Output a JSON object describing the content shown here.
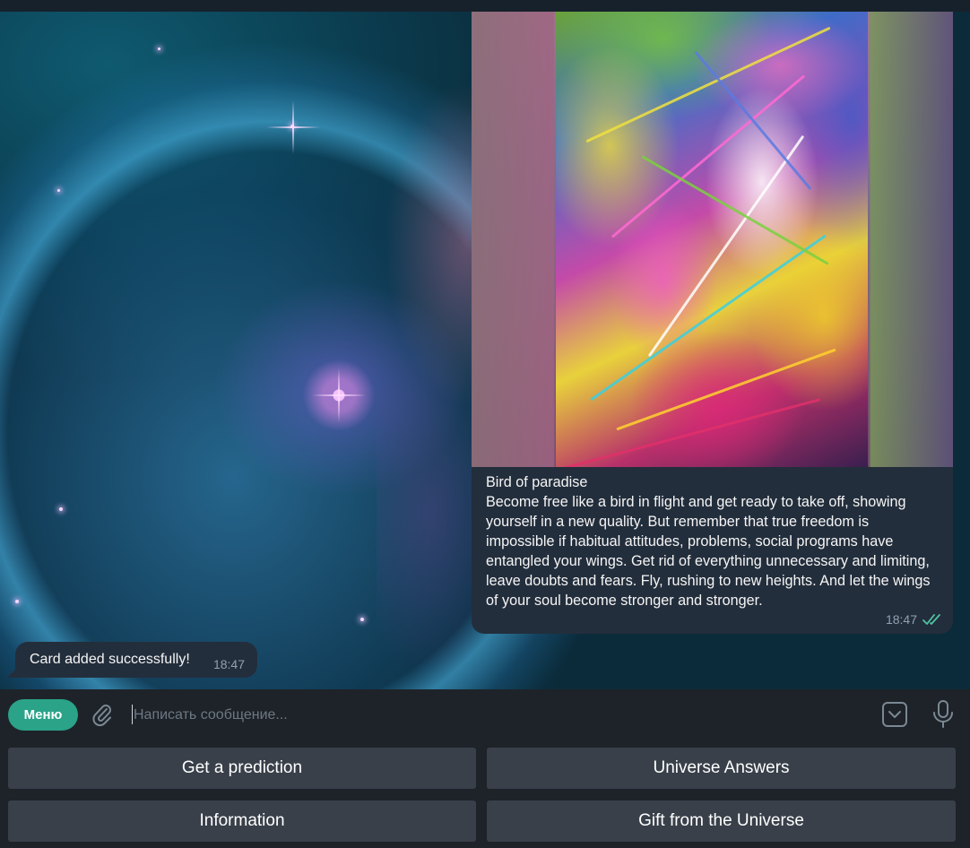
{
  "chat": {
    "image_message": {
      "caption_title": "Bird of paradise",
      "caption_body": "Become free like a bird in flight and get ready to take off, showing yourself in a new quality. But remember that true freedom is impossible if habitual attitudes, problems, social programs have entangled your wings. Get rid of everything unnecessary and limiting, leave doubts and fears. Fly, rushing to new heights. And let the wings of your soul become stronger and stronger.",
      "time": "18:47",
      "status_icon": "double-check-icon"
    },
    "reply_message": {
      "text": "Card added successfully!",
      "time": "18:47"
    }
  },
  "composer": {
    "menu_label": "Меню",
    "placeholder": "Написать сообщение...",
    "icons": [
      "paperclip-icon",
      "keyboard-toggle-icon",
      "microphone-icon"
    ]
  },
  "keyboard": {
    "buttons": [
      "Get a prediction",
      "Universe Answers",
      "Information",
      "Gift from the Universe"
    ]
  },
  "colors": {
    "accent": "#2aa388",
    "bubble": "#232e3c",
    "keyboard_button": "#39404a",
    "background": "#1e2329"
  }
}
